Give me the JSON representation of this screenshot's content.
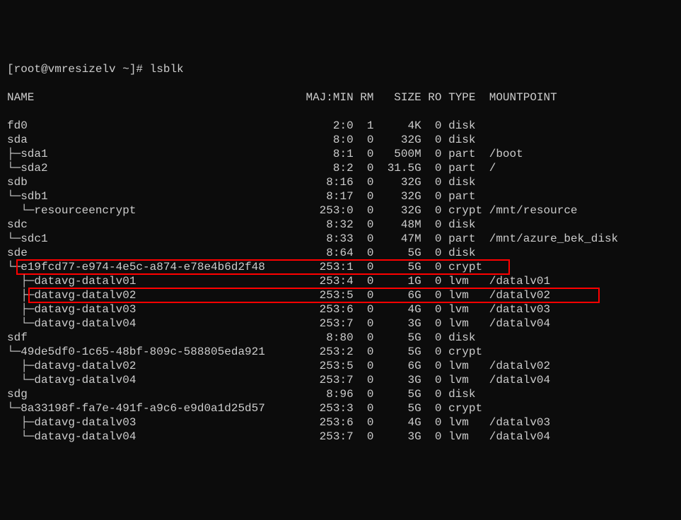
{
  "prompt": "[root@vmresizelv ~]# lsblk",
  "headers": {
    "name": "NAME",
    "majmin": "MAJ:MIN",
    "rm": "RM",
    "size": "SIZE",
    "ro": "RO",
    "type": "TYPE",
    "mountpoint": "MOUNTPOINT"
  },
  "rows": [
    {
      "name": "fd0",
      "majmin": "2:0",
      "rm": "1",
      "size": "4K",
      "ro": "0",
      "type": "disk",
      "mountpoint": "",
      "indent": 0,
      "tree": ""
    },
    {
      "name": "sda",
      "majmin": "8:0",
      "rm": "0",
      "size": "32G",
      "ro": "0",
      "type": "disk",
      "mountpoint": "",
      "indent": 0,
      "tree": ""
    },
    {
      "name": "sda1",
      "majmin": "8:1",
      "rm": "0",
      "size": "500M",
      "ro": "0",
      "type": "part",
      "mountpoint": "/boot",
      "indent": 0,
      "tree": "├─"
    },
    {
      "name": "sda2",
      "majmin": "8:2",
      "rm": "0",
      "size": "31.5G",
      "ro": "0",
      "type": "part",
      "mountpoint": "/",
      "indent": 0,
      "tree": "└─"
    },
    {
      "name": "sdb",
      "majmin": "8:16",
      "rm": "0",
      "size": "32G",
      "ro": "0",
      "type": "disk",
      "mountpoint": "",
      "indent": 0,
      "tree": ""
    },
    {
      "name": "sdb1",
      "majmin": "8:17",
      "rm": "0",
      "size": "32G",
      "ro": "0",
      "type": "part",
      "mountpoint": "",
      "indent": 0,
      "tree": "└─"
    },
    {
      "name": "resourceencrypt",
      "majmin": "253:0",
      "rm": "0",
      "size": "32G",
      "ro": "0",
      "type": "crypt",
      "mountpoint": "/mnt/resource",
      "indent": 1,
      "tree": "  └─"
    },
    {
      "name": "sdc",
      "majmin": "8:32",
      "rm": "0",
      "size": "48M",
      "ro": "0",
      "type": "disk",
      "mountpoint": "",
      "indent": 0,
      "tree": ""
    },
    {
      "name": "sdc1",
      "majmin": "8:33",
      "rm": "0",
      "size": "47M",
      "ro": "0",
      "type": "part",
      "mountpoint": "/mnt/azure_bek_disk",
      "indent": 0,
      "tree": "└─"
    },
    {
      "name": "sde",
      "majmin": "8:64",
      "rm": "0",
      "size": "5G",
      "ro": "0",
      "type": "disk",
      "mountpoint": "",
      "indent": 0,
      "tree": ""
    },
    {
      "name": "e19fcd77-e974-4e5c-a874-e78e4b6d2f48",
      "majmin": "253:1",
      "rm": "0",
      "size": "5G",
      "ro": "0",
      "type": "crypt",
      "mountpoint": "",
      "indent": 0,
      "tree": "└─",
      "highlight": 1
    },
    {
      "name": "datavg-datalv01",
      "majmin": "253:4",
      "rm": "0",
      "size": "1G",
      "ro": "0",
      "type": "lvm",
      "mountpoint": "/datalv01",
      "indent": 1,
      "tree": "  ├─"
    },
    {
      "name": "datavg-datalv02",
      "majmin": "253:5",
      "rm": "0",
      "size": "6G",
      "ro": "0",
      "type": "lvm",
      "mountpoint": "/datalv02",
      "indent": 1,
      "tree": "  ├─",
      "highlight": 2
    },
    {
      "name": "datavg-datalv03",
      "majmin": "253:6",
      "rm": "0",
      "size": "4G",
      "ro": "0",
      "type": "lvm",
      "mountpoint": "/datalv03",
      "indent": 1,
      "tree": "  ├─"
    },
    {
      "name": "datavg-datalv04",
      "majmin": "253:7",
      "rm": "0",
      "size": "3G",
      "ro": "0",
      "type": "lvm",
      "mountpoint": "/datalv04",
      "indent": 1,
      "tree": "  └─"
    },
    {
      "name": "sdf",
      "majmin": "8:80",
      "rm": "0",
      "size": "5G",
      "ro": "0",
      "type": "disk",
      "mountpoint": "",
      "indent": 0,
      "tree": ""
    },
    {
      "name": "49de5df0-1c65-48bf-809c-588805eda921",
      "majmin": "253:2",
      "rm": "0",
      "size": "5G",
      "ro": "0",
      "type": "crypt",
      "mountpoint": "",
      "indent": 0,
      "tree": "└─"
    },
    {
      "name": "datavg-datalv02",
      "majmin": "253:5",
      "rm": "0",
      "size": "6G",
      "ro": "0",
      "type": "lvm",
      "mountpoint": "/datalv02",
      "indent": 1,
      "tree": "  ├─"
    },
    {
      "name": "datavg-datalv04",
      "majmin": "253:7",
      "rm": "0",
      "size": "3G",
      "ro": "0",
      "type": "lvm",
      "mountpoint": "/datalv04",
      "indent": 1,
      "tree": "  └─"
    },
    {
      "name": "sdg",
      "majmin": "8:96",
      "rm": "0",
      "size": "5G",
      "ro": "0",
      "type": "disk",
      "mountpoint": "",
      "indent": 0,
      "tree": ""
    },
    {
      "name": "8a33198f-fa7e-491f-a9c6-e9d0a1d25d57",
      "majmin": "253:3",
      "rm": "0",
      "size": "5G",
      "ro": "0",
      "type": "crypt",
      "mountpoint": "",
      "indent": 0,
      "tree": "└─"
    },
    {
      "name": "datavg-datalv03",
      "majmin": "253:6",
      "rm": "0",
      "size": "4G",
      "ro": "0",
      "type": "lvm",
      "mountpoint": "/datalv03",
      "indent": 1,
      "tree": "  ├─"
    },
    {
      "name": "datavg-datalv04",
      "majmin": "253:7",
      "rm": "0",
      "size": "3G",
      "ro": "0",
      "type": "lvm",
      "mountpoint": "/datalv04",
      "indent": 1,
      "tree": "  └─"
    }
  ]
}
